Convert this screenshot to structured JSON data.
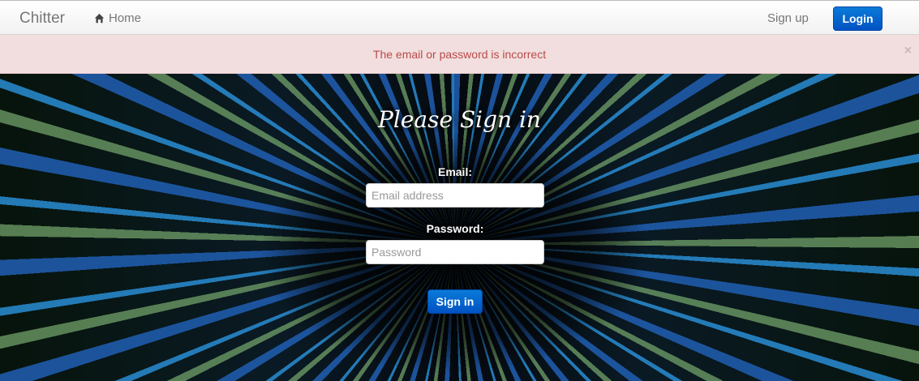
{
  "navbar": {
    "brand": "Chitter",
    "home_label": "Home",
    "signup_label": "Sign up",
    "login_label": "Login"
  },
  "alert": {
    "message": "The email or password is incorrect",
    "close_symbol": "×",
    "color": "#b94a48",
    "background": "#f2dede"
  },
  "form": {
    "title": "Please Sign in",
    "email_label": "Email:",
    "email_placeholder": "Email address",
    "email_value": "",
    "password_label": "Password:",
    "password_placeholder": "Password",
    "password_value": "",
    "submit_label": "Sign in"
  },
  "icons": {
    "home": "home-icon"
  },
  "colors": {
    "primary_button": "#0066cc"
  }
}
